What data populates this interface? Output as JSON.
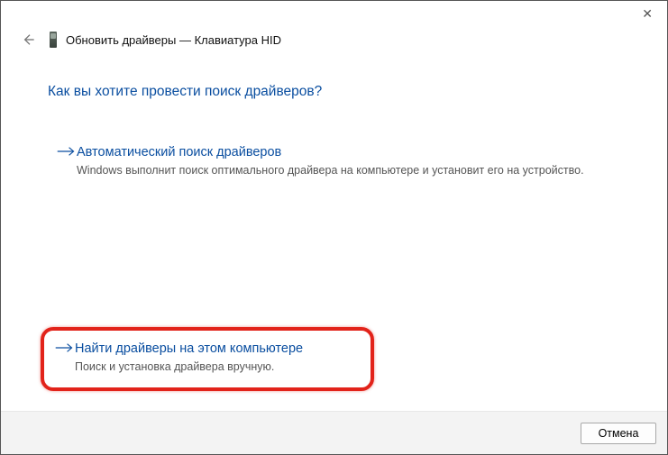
{
  "window": {
    "title": "Обновить драйверы — Клавиатура HID"
  },
  "heading": "Как вы хотите провести поиск драйверов?",
  "options": {
    "auto": {
      "title": "Автоматический поиск драйверов",
      "desc": "Windows выполнит поиск оптимального драйвера на компьютере и установит его на устройство."
    },
    "manual": {
      "title": "Найти драйверы на этом компьютере",
      "desc": "Поиск и установка драйвера вручную."
    }
  },
  "footer": {
    "cancel": "Отмена"
  }
}
